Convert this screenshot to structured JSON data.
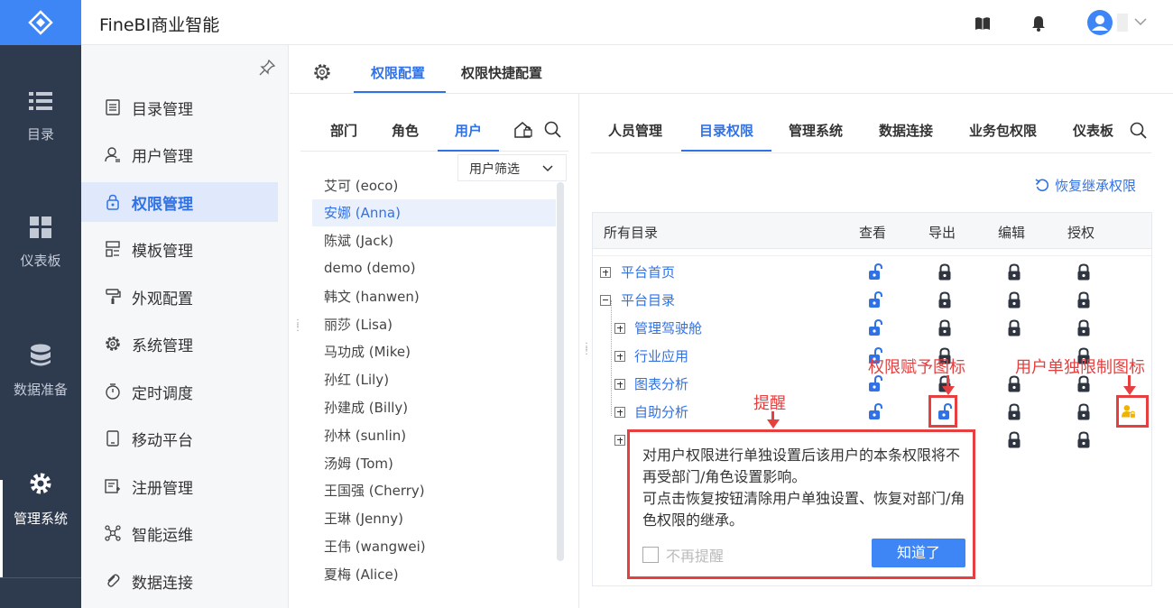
{
  "app": {
    "title": "FineBI商业智能",
    "accent": "#3072e6"
  },
  "rail": [
    {
      "label": "目录",
      "icon": "list-icon"
    },
    {
      "label": "仪表板",
      "icon": "dashboard-icon"
    },
    {
      "label": "数据准备",
      "icon": "database-icon"
    },
    {
      "label": "管理系统",
      "icon": "gear-icon",
      "active": true
    }
  ],
  "menu": [
    {
      "label": "目录管理",
      "icon": "catalog-icon"
    },
    {
      "label": "用户管理",
      "icon": "user-icon"
    },
    {
      "label": "权限管理",
      "icon": "lock-icon",
      "active": true
    },
    {
      "label": "模板管理",
      "icon": "template-icon"
    },
    {
      "label": "外观配置",
      "icon": "paint-roller-icon"
    },
    {
      "label": "系统管理",
      "icon": "settings-icon"
    },
    {
      "label": "定时调度",
      "icon": "timer-icon"
    },
    {
      "label": "移动平台",
      "icon": "mobile-icon"
    },
    {
      "label": "注册管理",
      "icon": "register-icon"
    },
    {
      "label": "智能运维",
      "icon": "ops-icon"
    },
    {
      "label": "数据连接",
      "icon": "link-icon"
    }
  ],
  "header_tabs": [
    "权限配置",
    "权限快捷配置"
  ],
  "user_tabs": [
    "部门",
    "角色",
    "用户"
  ],
  "user_filter": "用户筛选",
  "users": [
    "艾可 (eoco)",
    "安娜 (Anna)",
    "陈斌 (Jack)",
    "demo (demo)",
    "韩文 (hanwen)",
    "丽莎 (Lisa)",
    "马功成 (Mike)",
    "孙红 (Lily)",
    "孙建成 (Billy)",
    "孙林 (sunlin)",
    "汤姆 (Tom)",
    "王国强 (Cherry)",
    "王琳 (Jenny)",
    "王伟 (wangwei)",
    "夏梅 (Alice)"
  ],
  "perm_tabs": [
    "人员管理",
    "目录权限",
    "管理系统",
    "数据连接",
    "业务包权限",
    "仪表板"
  ],
  "restore_label": "恢复继承权限",
  "grid": {
    "headers": [
      "所有目录",
      "查看",
      "导出",
      "编辑",
      "授权"
    ],
    "rows": [
      {
        "label": "平台首页",
        "level": 0,
        "expander": "plus"
      },
      {
        "label": "平台目录",
        "level": 0,
        "expander": "minus"
      },
      {
        "label": "管理驾驶舱",
        "level": 1,
        "expander": "plus"
      },
      {
        "label": "行业应用",
        "level": 1,
        "expander": "plus"
      },
      {
        "label": "图表分析",
        "level": 1,
        "expander": "plus"
      },
      {
        "label": "自助分析",
        "level": 1,
        "expander": "plus"
      },
      {
        "label": "",
        "level": 1,
        "expander": "plus"
      }
    ]
  },
  "dialog": {
    "text1": "对用户权限进行单独设置后该用户的本条权限将不再受部门/角色设置影响。",
    "text2": "可点击恢复按钮清除用户单独设置、恢复对部门/角色权限的继承。",
    "checkbox": "不再提醒",
    "button": "知道了"
  },
  "annotations": {
    "grant": "权限赋予图标",
    "user_limit": "用户单独限制图标",
    "reminder": "提醒"
  }
}
